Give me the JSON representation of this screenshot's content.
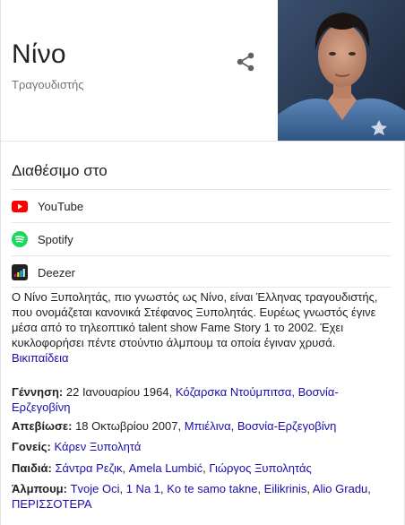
{
  "entity": {
    "name": "Νίνο",
    "type": "Τραγουδιστής"
  },
  "available_on": {
    "title": "Διαθέσιμο στο",
    "services": [
      {
        "label": "YouTube",
        "icon": "youtube-icon",
        "color": "#ff0000"
      },
      {
        "label": "Spotify",
        "icon": "spotify-icon",
        "color": "#1ed760"
      },
      {
        "label": "Deezer",
        "icon": "deezer-icon",
        "color": "#222222"
      }
    ]
  },
  "description": {
    "text": "Ο Νίνο Ξυπολητάς, πιο γνωστός ως Νίνο, είναι Έλληνας τραγουδιστής, που ονομάζεται κανονικά Στέφανος Ξυπολητάς. Ευρέως γνωστός έγινε μέσα από το τηλεοπτικό talent show Fame Story 1 το 2002. Έχει κυκλοφορήσει πέντε στούντιο άλμπουμ τα οποία έγιναν χρυσά.",
    "source": "Βικιπαίδεια"
  },
  "facts": {
    "birth": {
      "label": "Γέννηση:",
      "value": "22 Ιανουαρίου 1964,",
      "place": "Κόζαρσκα Ντούμπιτσα, Βοσνία-Ερζεγοβίνη"
    },
    "death": {
      "label": "Απεβίωσε:",
      "value": "18 Οκτωβρίου 2007,",
      "place": "Μπιέλινα, Βοσνία-Ερζεγοβίνη"
    },
    "parents": {
      "label": "Γονείς:",
      "items": [
        "Κάρεν Ξυπολητά"
      ]
    },
    "children": {
      "label": "Παιδιά:",
      "items": [
        "Σάντρα Ρεζικ",
        "Amela Lumbić",
        "Γιώργος Ξυπολητάς"
      ]
    },
    "albums": {
      "label": "Άλμπουμ:",
      "items": [
        "Tvoje Oci",
        "1 Na 1",
        "Ko te samo takne",
        "Eilikrinis",
        "Alio Gradu"
      ],
      "more": "ΠΕΡΙΣΣΟΤΕΡΑ"
    }
  },
  "colors": {
    "link": "#1a0dab",
    "muted": "#70757a",
    "divider": "#e6e6e6"
  }
}
